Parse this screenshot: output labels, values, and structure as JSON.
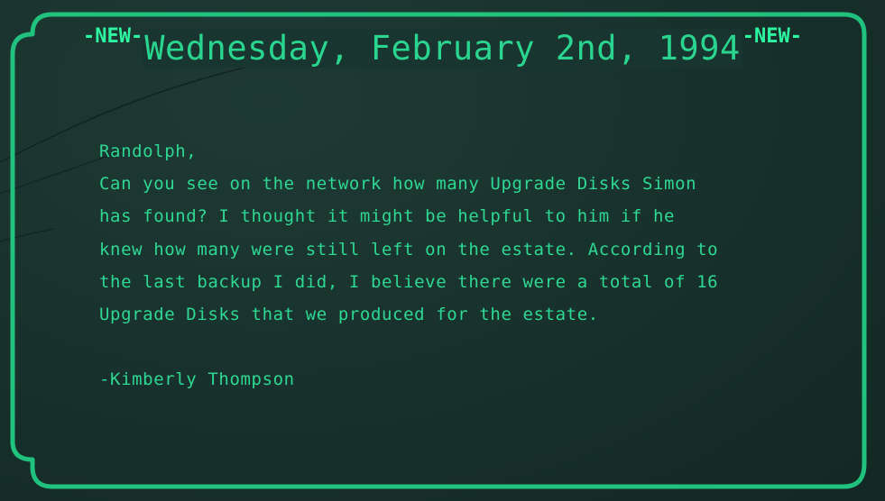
{
  "header": {
    "badge_left": "-NEW-",
    "badge_right": "-NEW-",
    "date_title": "Wednesday, February 2nd, 1994"
  },
  "message": {
    "salutation": "Randolph,",
    "lines": [
      "Can you see on the network how many Upgrade Disks Simon",
      "has found? I thought it might be helpful to him if he",
      "knew how many were still left on the estate. According to",
      "the last backup I did, I believe there were a total of 16",
      "Upgrade Disks that we produced for the estate."
    ],
    "signature": "-Kimberly Thompson"
  },
  "colors": {
    "background": "#17302b",
    "frame": "#20c27e",
    "text": "#2ed892",
    "badge": "#2df7a0"
  }
}
